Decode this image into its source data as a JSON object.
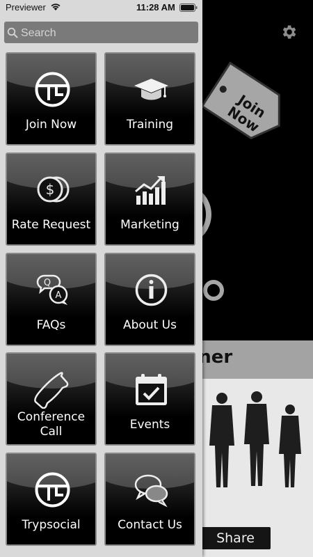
{
  "status_bar": {
    "carrier": "Previewer",
    "time": "11:28 AM"
  },
  "search": {
    "placeholder": "Search"
  },
  "menu": {
    "items": [
      {
        "label": "Join Now",
        "icon": "trypsocial-logo-icon"
      },
      {
        "label": "Training",
        "icon": "graduation-cap-icon"
      },
      {
        "label": "Rate Request",
        "icon": "dollar-coins-icon"
      },
      {
        "label": "Marketing",
        "icon": "growth-chart-icon"
      },
      {
        "label": "FAQs",
        "icon": "qa-bubbles-icon"
      },
      {
        "label": "About Us",
        "icon": "info-icon"
      },
      {
        "label": "Conference Call",
        "icon": "phone-icon"
      },
      {
        "label": "Events",
        "icon": "calendar-check-icon"
      },
      {
        "label": "Trypsocial",
        "icon": "trypsocial-logo-icon"
      },
      {
        "label": "Contact Us",
        "icon": "chat-bubbles-icon"
      }
    ]
  },
  "background": {
    "tag_text": "Join Now",
    "partner_text": "rtner",
    "share_label": "Share"
  },
  "colors": {
    "menu_bg": "#d9d9d9",
    "tile_bg": "#000000",
    "search_bg": "#7a7a7a"
  }
}
